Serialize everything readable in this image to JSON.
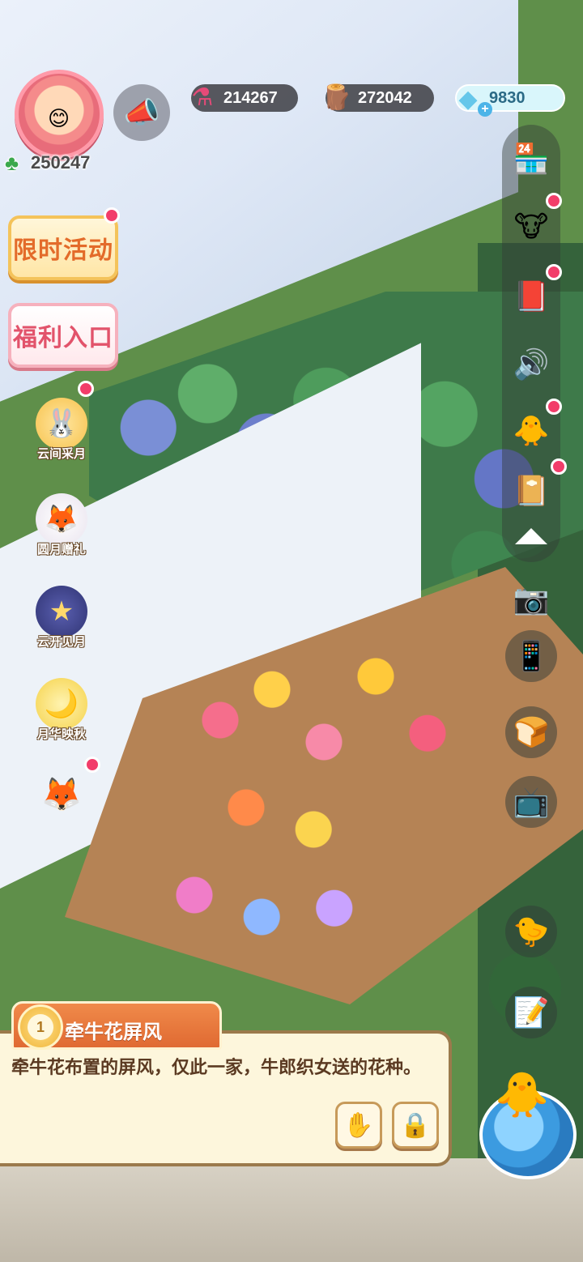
{
  "player": {
    "likes": "250247",
    "avatar_icon": "girl-avatar-icon"
  },
  "resources": {
    "potion": "214267",
    "wood": "272042",
    "gems": "9830",
    "gem_add": "+"
  },
  "left_buttons": {
    "event": "限时活动",
    "welfare": "福利入口"
  },
  "event_characters": [
    {
      "label": "云间采月",
      "icon": "bunny-girl-icon"
    },
    {
      "label": "圆月赠礼",
      "icon": "white-fox-icon"
    },
    {
      "label": "云开见月",
      "icon": "star-hat-icon"
    },
    {
      "label": "月华映秋",
      "icon": "moon-girl-icon"
    }
  ],
  "right_bar": {
    "items": [
      "shop-icon",
      "cow-friends-icon",
      "book-icon",
      "speaker-icon",
      "chick-wing-icon",
      "journal-icon"
    ],
    "collapse": "collapse-arrow-icon"
  },
  "right_tools": [
    "camera-icon",
    "phone-icon",
    "bun-pile-icon",
    "tv-icon",
    "couple-chick-icon",
    "notebook-icon"
  ],
  "info_panel": {
    "rank": "1",
    "title": "牵牛花屏风",
    "description": "牵牛花布置的屏风，仅此一家，牛郎织女送的花种。",
    "buttons": [
      "move-icon",
      "lock-icon"
    ]
  },
  "colors": {
    "accent_orange": "#e06a32",
    "panel_bg": "#fdf6dc",
    "reddot": "#f23d6a"
  }
}
